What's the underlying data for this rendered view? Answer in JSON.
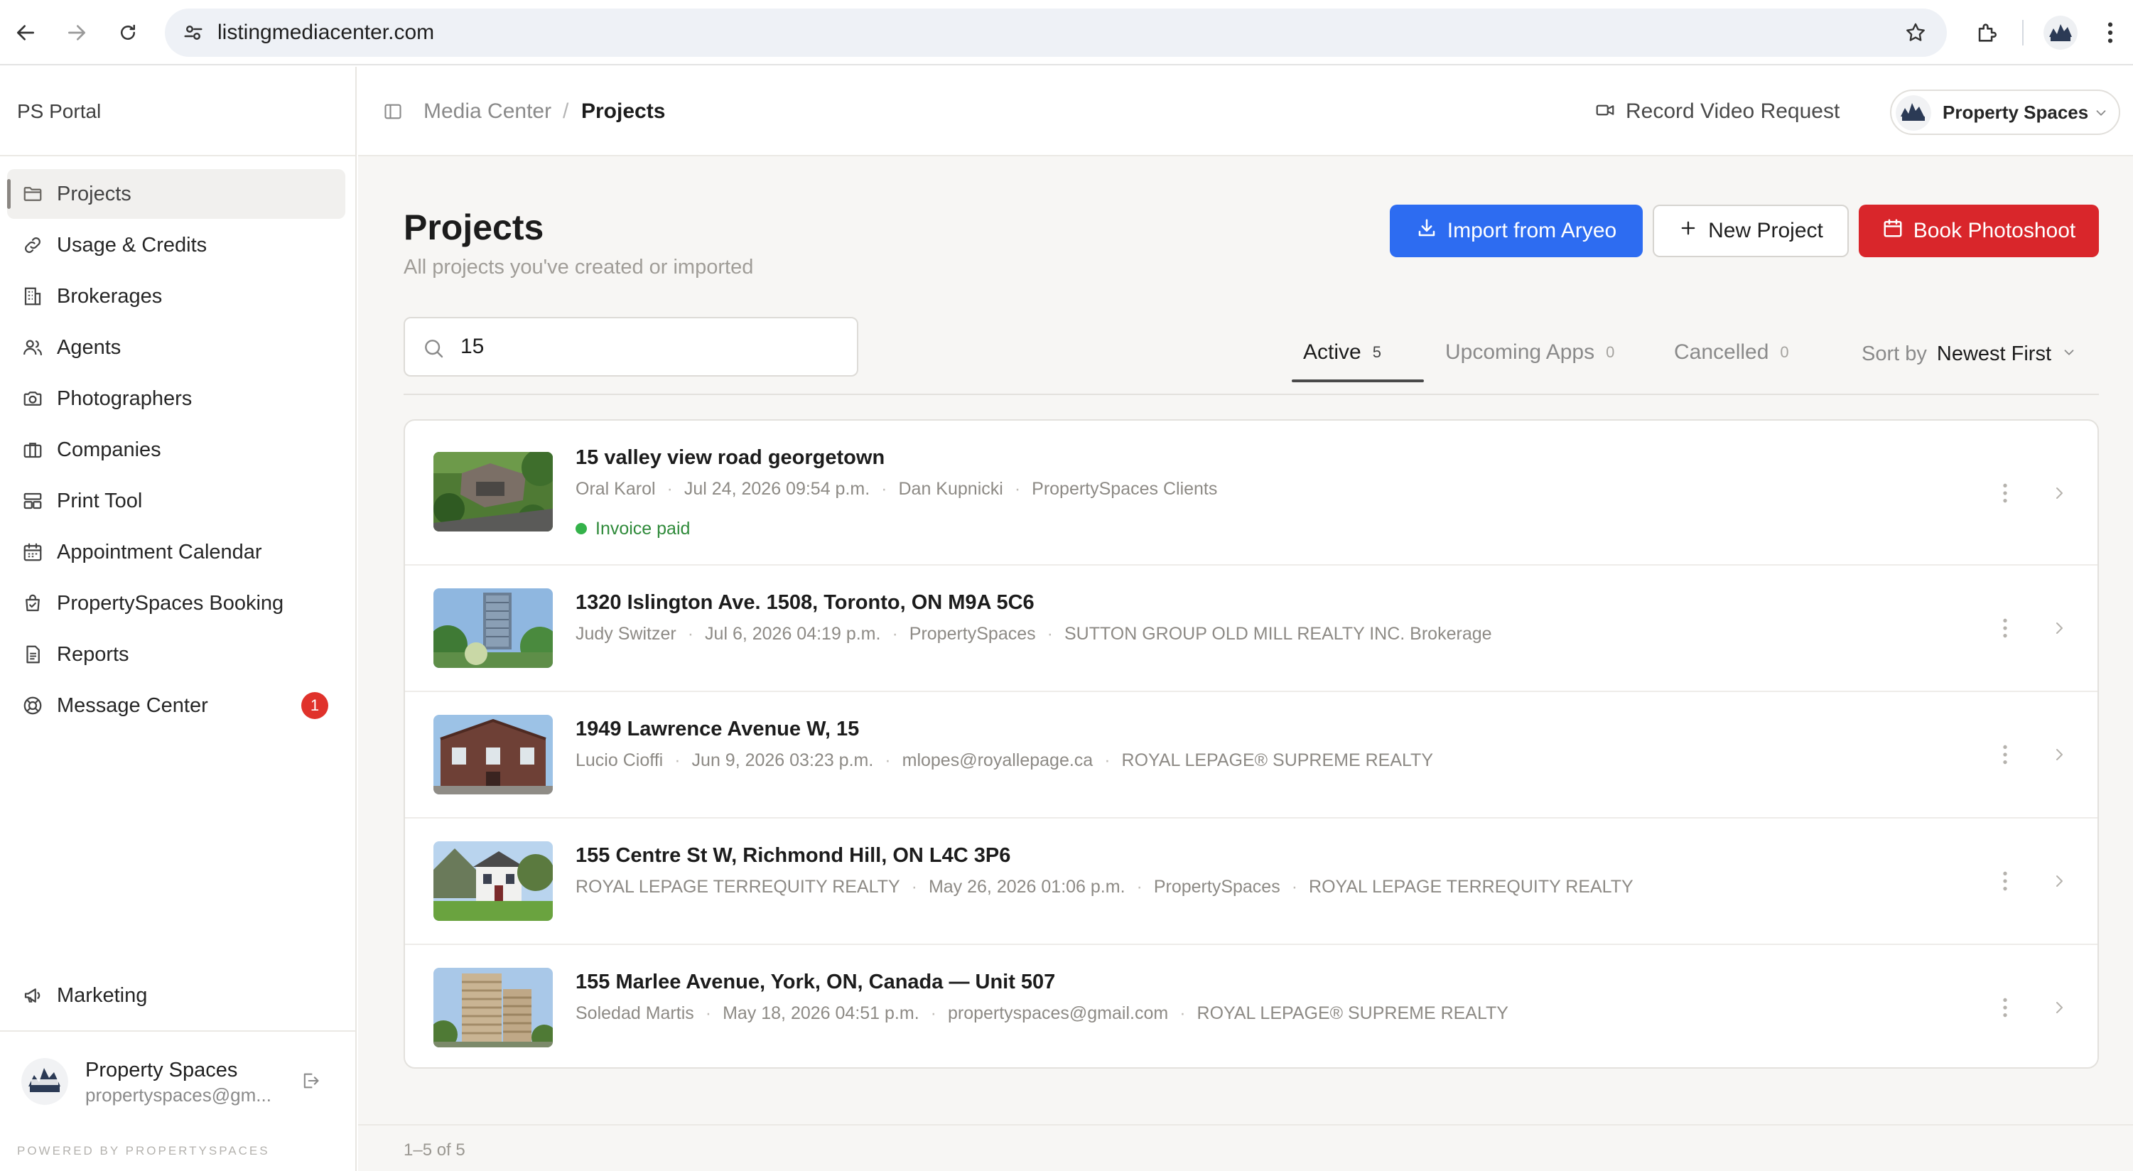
{
  "browser": {
    "url": "listingmediacenter.com",
    "icons": [
      "back-icon",
      "forward-icon",
      "reload-icon",
      "site-settings-icon",
      "star-icon",
      "extensions-icon",
      "chrome-menu-icon"
    ]
  },
  "sidebar": {
    "brand": "PS Portal",
    "items": [
      {
        "label": "Projects",
        "icon": "folder-icon",
        "active": true
      },
      {
        "label": "Usage & Credits",
        "icon": "link-icon"
      },
      {
        "label": "Brokerages",
        "icon": "building-icon"
      },
      {
        "label": "Agents",
        "icon": "users-icon"
      },
      {
        "label": "Photographers",
        "icon": "camera-icon"
      },
      {
        "label": "Companies",
        "icon": "briefcase-icon"
      },
      {
        "label": "Print Tool",
        "icon": "print-layout-icon"
      },
      {
        "label": "Appointment Calendar",
        "icon": "calendar-icon"
      },
      {
        "label": "PropertySpaces Booking",
        "icon": "booking-icon"
      },
      {
        "label": "Reports",
        "icon": "report-icon"
      },
      {
        "label": "Message Center",
        "icon": "lifebuoy-icon",
        "badge": "1"
      }
    ],
    "marketing": {
      "label": "Marketing",
      "icon": "megaphone-icon"
    },
    "user": {
      "name": "Property Spaces",
      "email": "propertyspaces@gm..."
    },
    "powered_by": "POWERED BY PROPERTYSPACES"
  },
  "topbar": {
    "breadcrumb": [
      "Media Center",
      "Projects"
    ],
    "breadcrumb_sep": "/",
    "record_video": "Record Video Request",
    "account_name": "Property Spaces"
  },
  "page": {
    "title": "Projects",
    "subtitle": "All projects you've created or imported",
    "buttons": {
      "import": "Import from Aryeo",
      "new": "New Project",
      "book": "Book Photoshoot"
    },
    "search_value": "15",
    "tabs": [
      {
        "label": "Active",
        "count": "5",
        "active": true
      },
      {
        "label": "Upcoming Apps",
        "count": "0"
      },
      {
        "label": "Cancelled",
        "count": "0"
      }
    ],
    "sort_label": "Sort by",
    "sort_value": "Newest First",
    "colors": {
      "primary": "#2d6cf1",
      "danger": "#d9262b",
      "success": "#34b24a",
      "badge": "#e0322b"
    }
  },
  "projects": [
    {
      "title": "15 valley view road georgetown",
      "meta": [
        "Oral Karol",
        "Jul 24, 2026 09:54 p.m.",
        "Dan Kupnicki",
        "PropertySpaces Clients"
      ],
      "status": "Invoice paid"
    },
    {
      "title": "1320 Islington Ave. 1508, Toronto, ON M9A 5C6",
      "meta": [
        "Judy Switzer",
        "Jul 6, 2026 04:19 p.m.",
        "PropertySpaces",
        "SUTTON GROUP OLD MILL REALTY INC. Brokerage"
      ]
    },
    {
      "title": "1949 Lawrence Avenue W, 15",
      "meta": [
        "Lucio Cioffi",
        "Jun 9, 2026 03:23 p.m.",
        "mlopes@royallepage.ca",
        "ROYAL LEPAGE® SUPREME REALTY"
      ]
    },
    {
      "title": "155 Centre St W, Richmond Hill, ON L4C 3P6",
      "meta": [
        "ROYAL LEPAGE TERREQUITY REALTY",
        "May 26, 2026 01:06 p.m.",
        "PropertySpaces",
        "ROYAL LEPAGE TERREQUITY REALTY"
      ]
    },
    {
      "title": "155 Marlee Avenue, York, ON, Canada — Unit 507",
      "meta": [
        "Soledad Martis",
        "May 18, 2026 04:51 p.m.",
        "propertyspaces@gmail.com",
        "ROYAL LEPAGE® SUPREME REALTY"
      ]
    }
  ],
  "pagination": "1–5 of 5"
}
